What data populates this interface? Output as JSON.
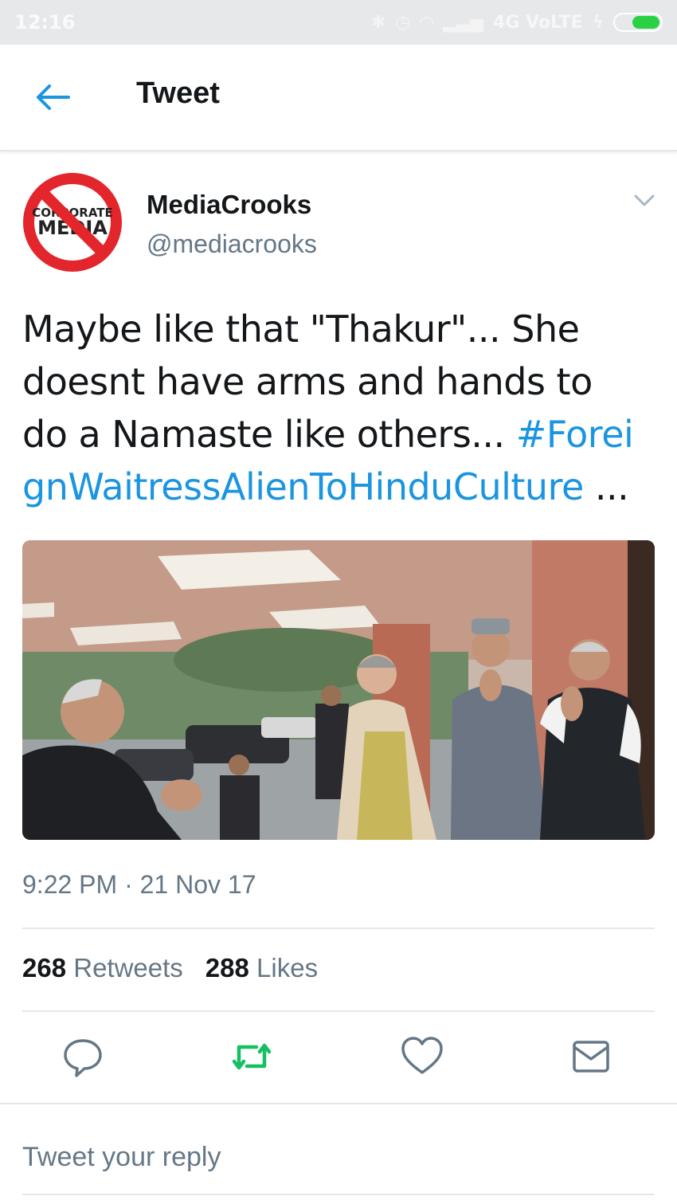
{
  "status_bar": {
    "time": "12:16",
    "network": "4G VoLTE",
    "battery_level": 0.7
  },
  "header": {
    "title": "Tweet"
  },
  "tweet": {
    "author_name": "MediaCrooks",
    "author_handle": "@mediacrooks",
    "avatar_text_top": "CORPORATE",
    "avatar_text_bottom": "MEDIA",
    "text_line_1": "Maybe like that \"Thakur\"... She",
    "text_line_2": "doesnt have arms and hands to",
    "text_line_3_plain": "do a Namaste like others... ",
    "text_line_3_tag": "#Forei",
    "text_line_4_tag": "gnWaitressAlienToHinduCulture",
    "text_line_4_plain": " ...",
    "timestamp": "9:22 PM · 21 Nov 17",
    "retweets_count": "268",
    "retweets_label": "Retweets",
    "likes_count": "288",
    "likes_label": "Likes"
  },
  "reply": {
    "placeholder": "Tweet your reply"
  },
  "colors": {
    "link": "#1b95e0",
    "secondary_text": "#657786",
    "retweet_green": "#17bf63",
    "divider": "#e1e8ed"
  }
}
